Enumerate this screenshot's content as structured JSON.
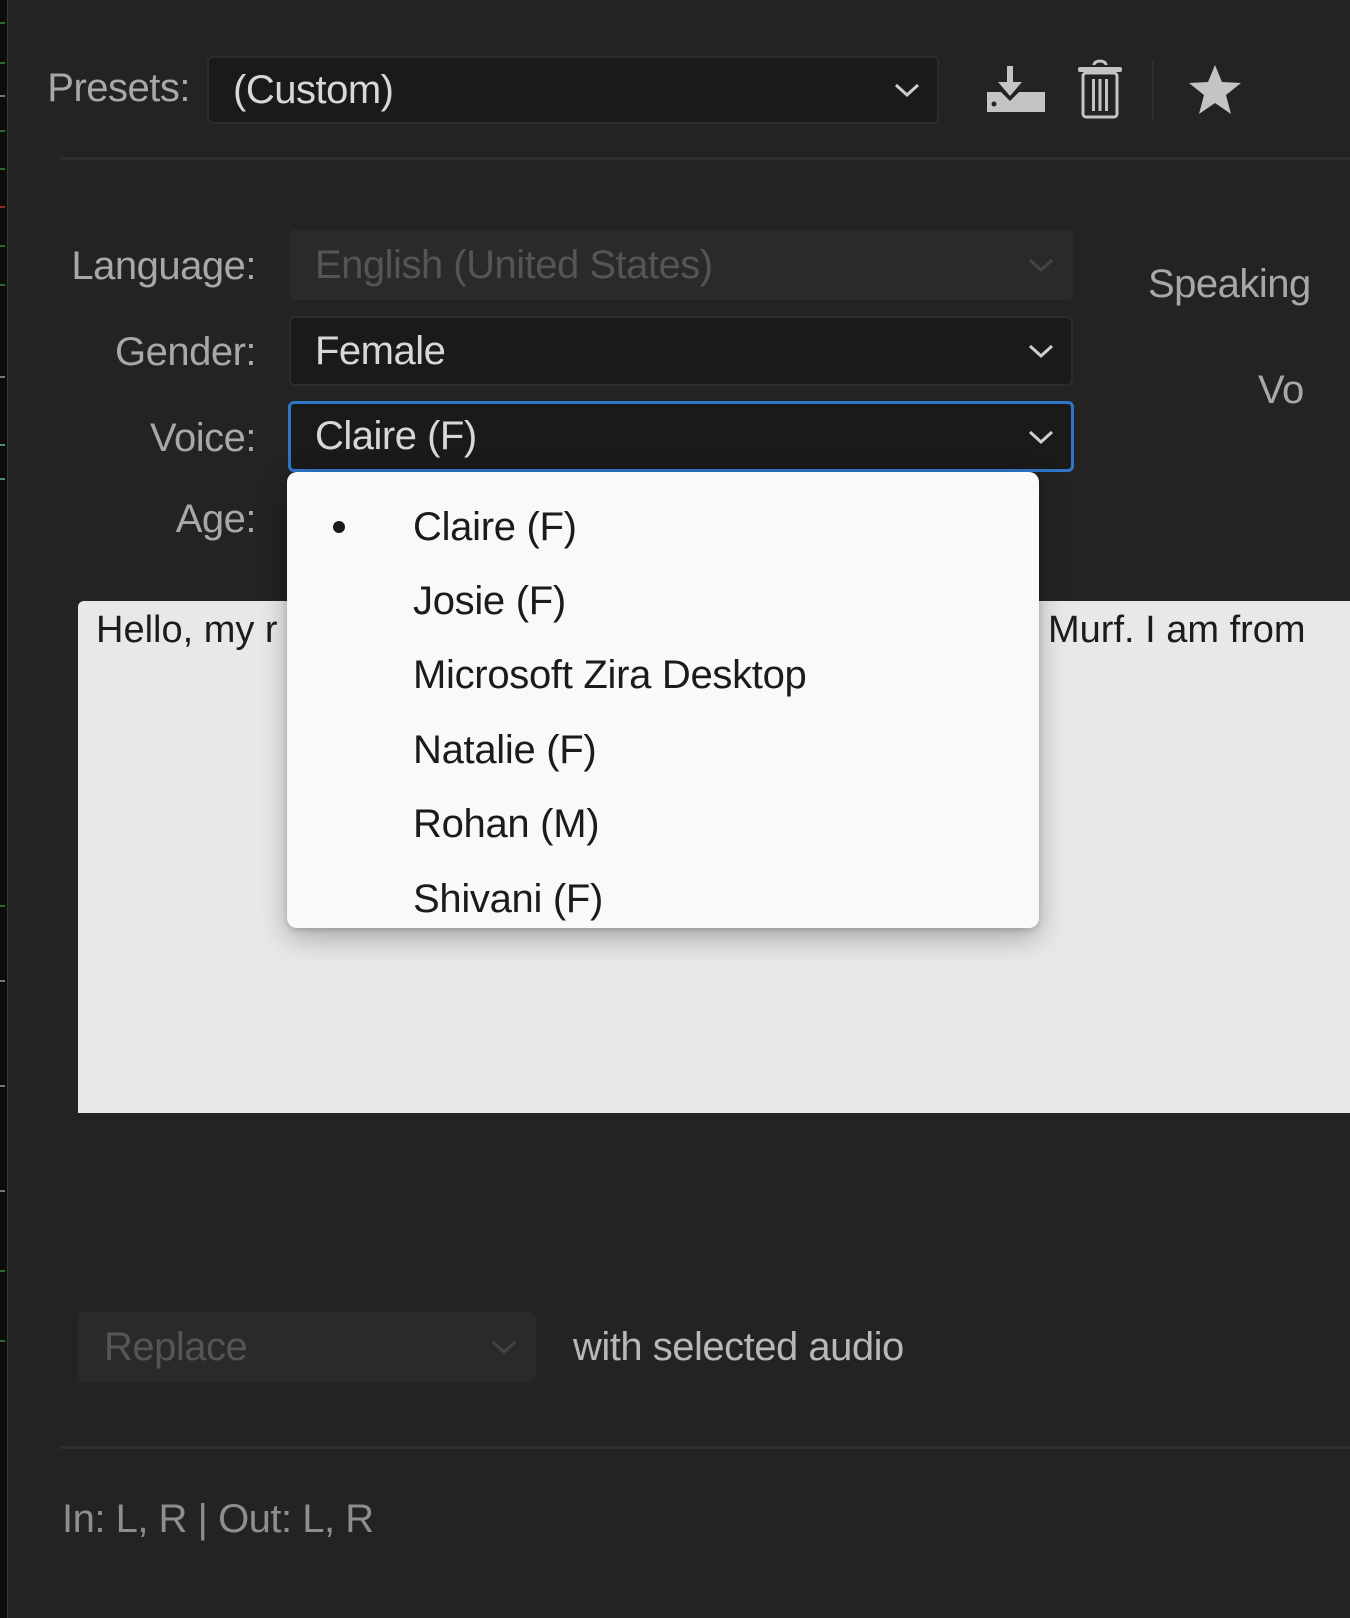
{
  "presets": {
    "label": "Presets:",
    "value": "(Custom)",
    "save_icon": "save-preset-icon",
    "delete_icon": "trash-icon",
    "favorite_icon": "star-icon"
  },
  "fields": {
    "language": {
      "label": "Language:",
      "value": "English (United States)",
      "disabled": true
    },
    "gender": {
      "label": "Gender:",
      "value": "Female"
    },
    "voice": {
      "label": "Voice:",
      "value": "Claire (F)",
      "focused": true
    },
    "age": {
      "label": "Age:"
    }
  },
  "right_panel": {
    "speaking_label": "Speaking",
    "vo_label": "Vo"
  },
  "voice_menu": {
    "selected_index": 0,
    "items": [
      "Claire (F)",
      "Josie (F)",
      "Microsoft Zira Desktop",
      "Natalie (F)",
      "Rohan (M)",
      "Shivani (F)"
    ]
  },
  "text_input": {
    "visible_left": "Hello, my r",
    "visible_right": "Murf. I am from"
  },
  "output": {
    "mode_value": "Replace",
    "mode_disabled": true,
    "suffix": "with selected audio"
  },
  "footer": {
    "channels": "In: L, R | Out: L, R"
  },
  "colors": {
    "background": "#232323",
    "focus_accent": "#2f76c9",
    "menu_background": "#f9f9f9",
    "textarea_background": "#e8e8e8"
  }
}
